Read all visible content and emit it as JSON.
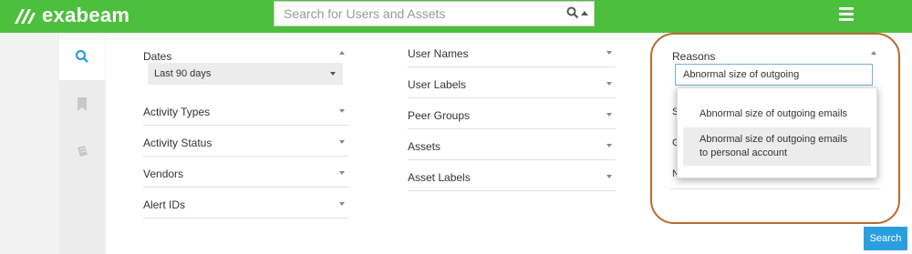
{
  "app": {
    "logo_text": "exabeam"
  },
  "search": {
    "placeholder": "Search for Users and Assets"
  },
  "col1": {
    "dates_label": "Dates",
    "dates_value": "Last 90 days",
    "fields": [
      "Activity Types",
      "Activity Status",
      "Vendors",
      "Alert IDs"
    ]
  },
  "col2": {
    "fields": [
      "User Names",
      "User Labels",
      "Peer Groups",
      "Assets",
      "Asset Labels"
    ]
  },
  "col3": {
    "reasons_label": "Reasons",
    "reasons_input": "Abnormal size of outgoing",
    "options": [
      "Abnormal size of outgoing emails",
      "Abnormal size of outgoing emails to personal account"
    ],
    "hidden_fragments": [
      "S",
      "G",
      "N"
    ]
  },
  "actions": {
    "search_label": "Search"
  },
  "colors": {
    "brand": "#4cbf3c",
    "accent": "#2b9ee0",
    "highlight_ring": "#b86a2f"
  },
  "icons": {
    "rail": [
      "search-icon",
      "bookmark-icon",
      "book-icon"
    ],
    "logo": "exabeam-logo-icon"
  }
}
